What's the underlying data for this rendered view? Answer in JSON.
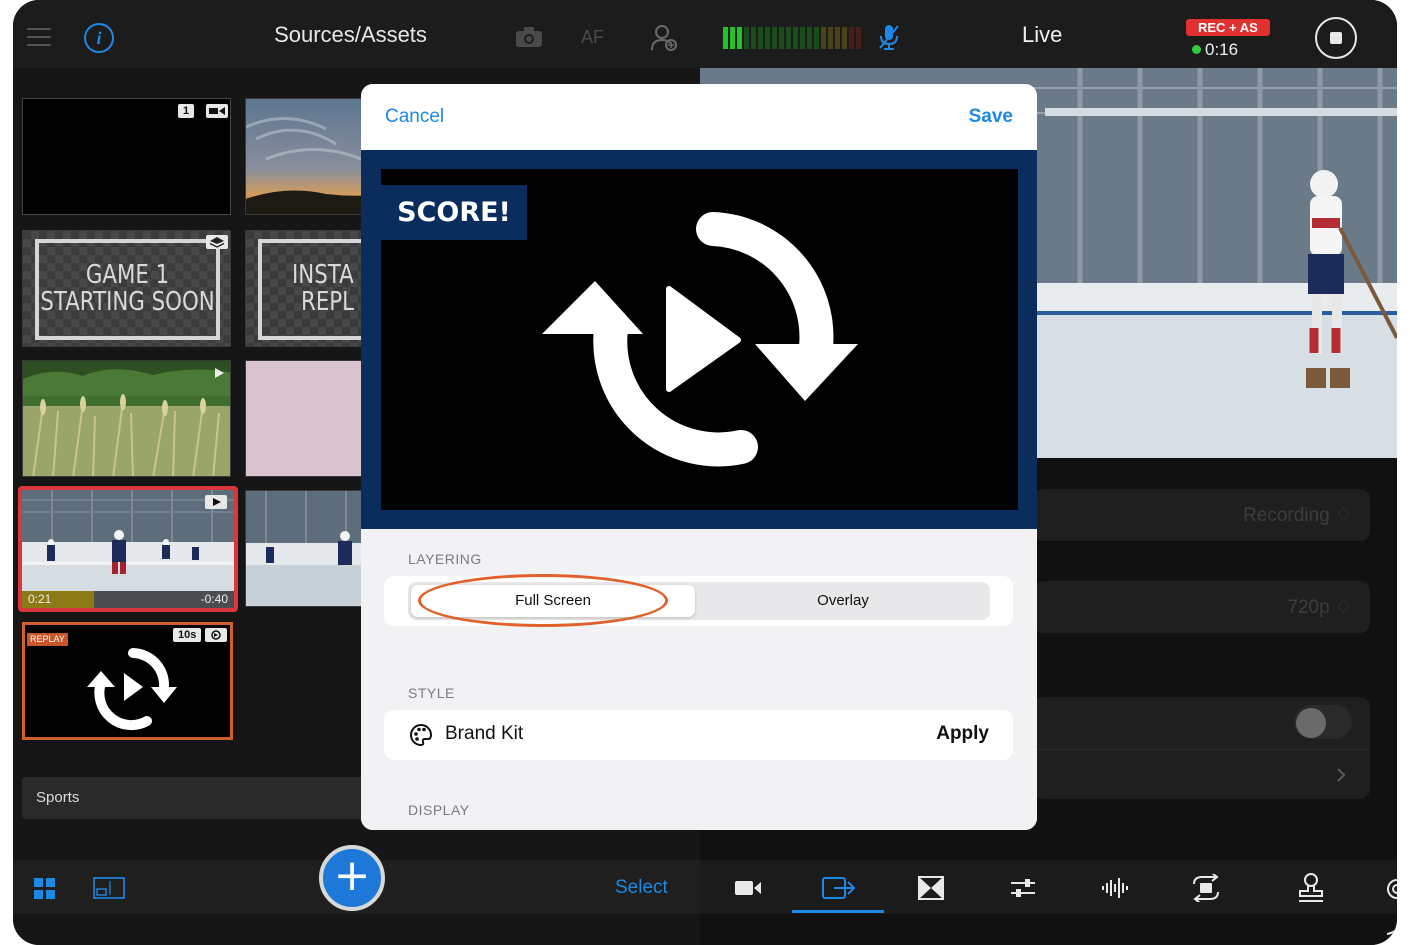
{
  "left_panel": {
    "title": "Sources/Assets",
    "af_label": "AF",
    "tiles": {
      "black_badge": "1",
      "game_text_line1": "GAME 1",
      "game_text_line2": "STARTING SOON",
      "instant_text_line1": "INSTA",
      "instant_text_line2": "REPL",
      "hockey_elapsed": "0:21",
      "hockey_remaining": "-0:40",
      "hockey_progress": 0.34,
      "replay_tag": "REPLAY",
      "replay_duration": "10s"
    },
    "collection_label": "Sports",
    "select_label": "Select",
    "add_label": "+"
  },
  "right_panel": {
    "title": "Live",
    "rec_badge": "REC + AS",
    "rec_time": "0:16",
    "recording_value": "Recording ♢",
    "resolution_value": "720p ♢",
    "toggle_on": false
  },
  "modal": {
    "cancel_label": "Cancel",
    "save_label": "Save",
    "score_tag": "SCORE!",
    "layering_label": "LAYERING",
    "layering_options": [
      "Full Screen",
      "Overlay"
    ],
    "layering_selected": "Full Screen",
    "style_label": "STYLE",
    "brand_kit_label": "Brand Kit",
    "apply_label": "Apply",
    "display_label": "DISPLAY"
  },
  "colors": {
    "accent": "#1e88e5",
    "rec_red": "#e03030",
    "live_green": "#2ecc40",
    "highlight": "#e0622a",
    "graphic_navy": "#0b2d5e"
  }
}
